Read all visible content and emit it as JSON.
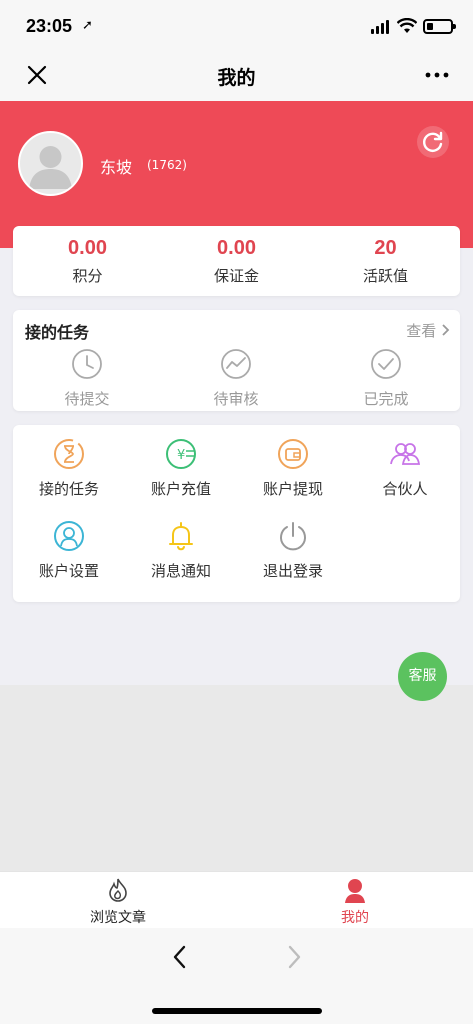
{
  "status_bar": {
    "time": "23:05"
  },
  "nav": {
    "title": "我的"
  },
  "profile": {
    "name": "东坡",
    "id": "(1762)"
  },
  "stats": [
    {
      "value": "0.00",
      "label": "积分"
    },
    {
      "value": "0.00",
      "label": "保证金"
    },
    {
      "value": "20",
      "label": "活跃值"
    }
  ],
  "tasks": {
    "title": "接的任务",
    "view_label": "查看",
    "items": [
      {
        "label": "待提交",
        "icon": "clock-icon"
      },
      {
        "label": "待审核",
        "icon": "trend-icon"
      },
      {
        "label": "已完成",
        "icon": "check-circle-icon"
      }
    ]
  },
  "menu": {
    "items": [
      {
        "label": "接的任务",
        "icon": "hourglass-icon",
        "color": "#f0a45a"
      },
      {
        "label": "账户充值",
        "icon": "yen-card-icon",
        "color": "#3cbf76"
      },
      {
        "label": "账户提现",
        "icon": "wallet-icon",
        "color": "#f0a45a"
      },
      {
        "label": "合伙人",
        "icon": "partners-icon",
        "color": "#c774e8"
      },
      {
        "label": "账户设置",
        "icon": "user-settings-icon",
        "color": "#3cb5d5"
      },
      {
        "label": "消息通知",
        "icon": "bell-icon",
        "color": "#f5c518"
      },
      {
        "label": "退出登录",
        "icon": "power-icon",
        "color": "#999999"
      }
    ]
  },
  "service_button": {
    "label": "客服"
  },
  "tab_bar": {
    "items": [
      {
        "label": "浏览文章",
        "icon": "flame-icon",
        "active": false
      },
      {
        "label": "我的",
        "icon": "profile-icon",
        "active": true
      }
    ]
  },
  "colors": {
    "brand": "#ee4a57",
    "active_tab": "#e04550",
    "service": "#5bc25f"
  }
}
